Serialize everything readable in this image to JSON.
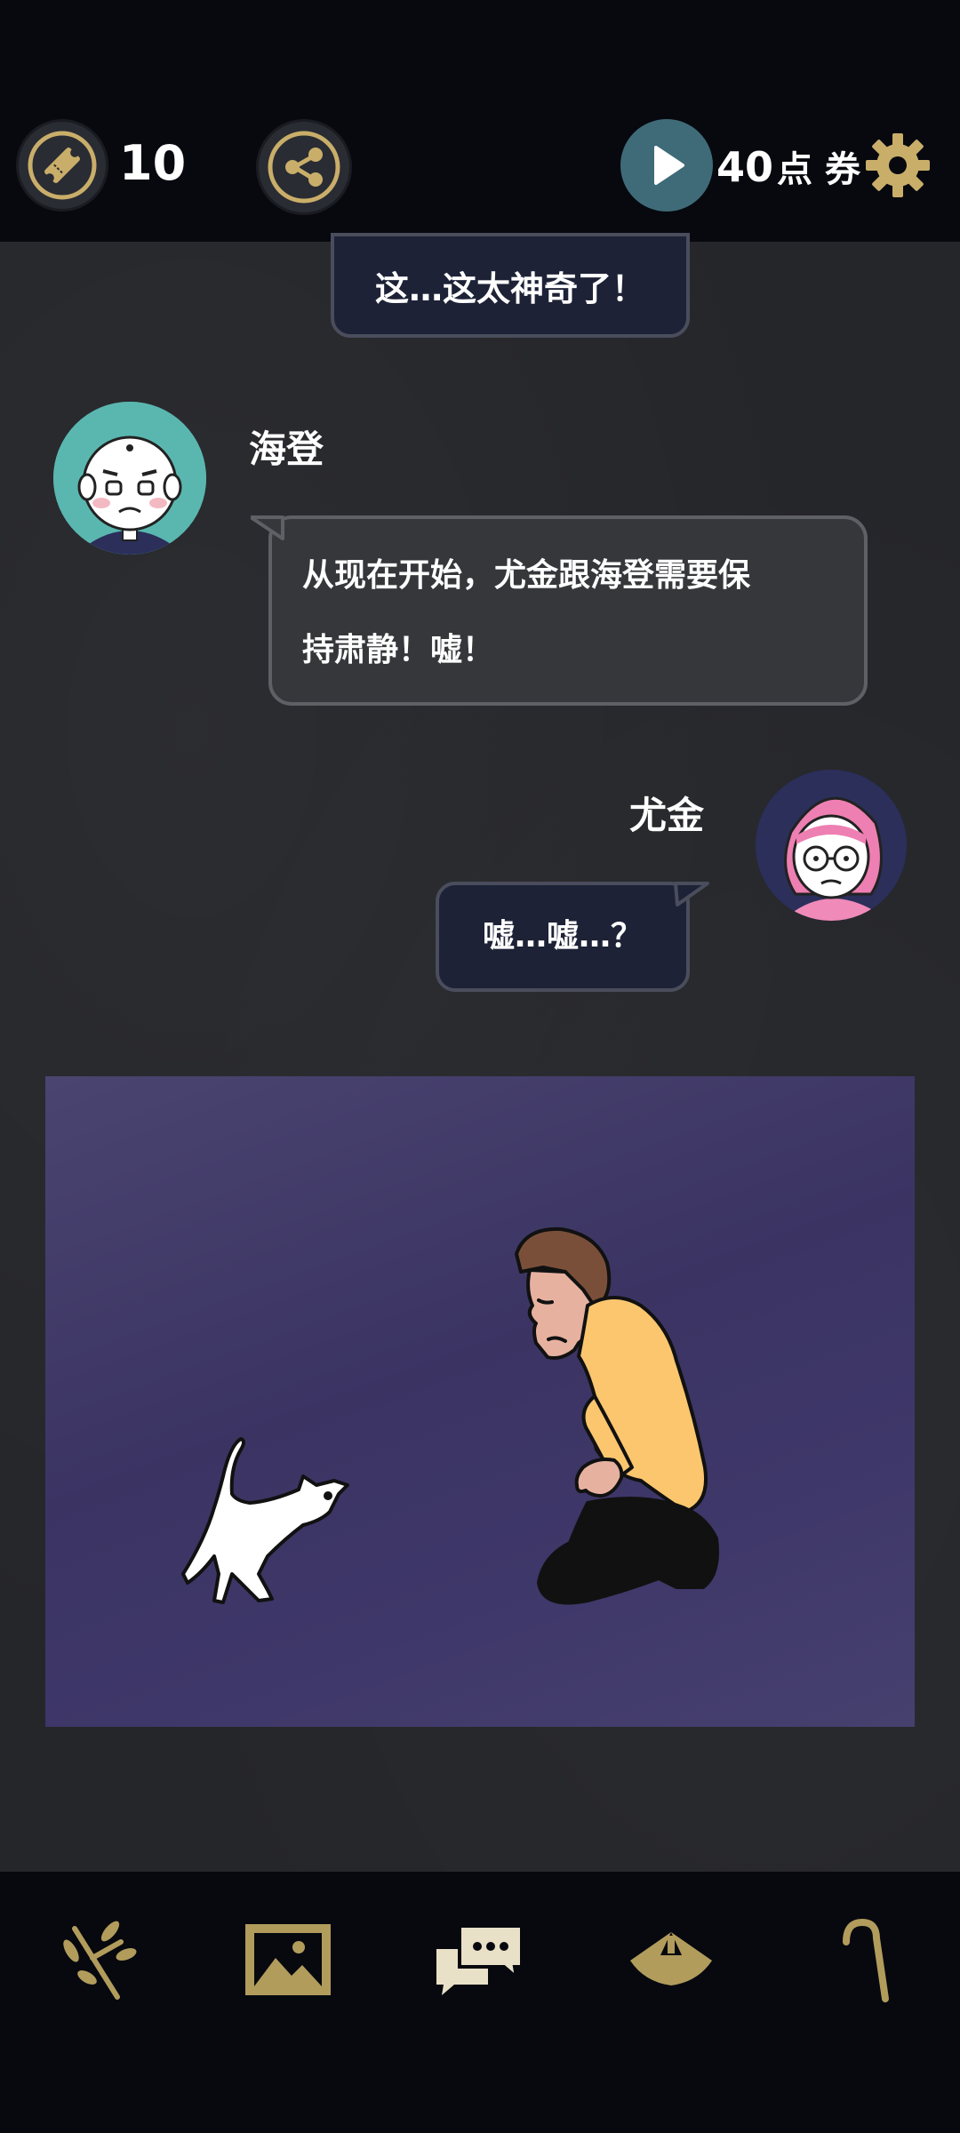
{
  "header": {
    "ticket_count": "10",
    "points_value": "40",
    "points_unit": "点 券"
  },
  "messages": [
    {
      "speaker": "",
      "text": "这…这太神奇了！"
    },
    {
      "speaker": "海登",
      "text_line1": "从现在开始，尤金跟海登需要保",
      "text_line2": "持肃静！嘘！"
    },
    {
      "speaker": "尤金",
      "text": "嘘…嘘…？"
    }
  ],
  "colors": {
    "accent_gold": "#c9ae6a",
    "play_button": "#3f6b78",
    "bubble_dark": "#1d2236",
    "bubble_gray": "#36373b"
  },
  "icons": {
    "ticket": "ticket-icon",
    "share": "share-icon",
    "play": "play-icon",
    "settings": "gear-icon",
    "nav": [
      "branch-icon",
      "gallery-icon",
      "chat-icon",
      "hat-icon",
      "cane-icon"
    ]
  }
}
